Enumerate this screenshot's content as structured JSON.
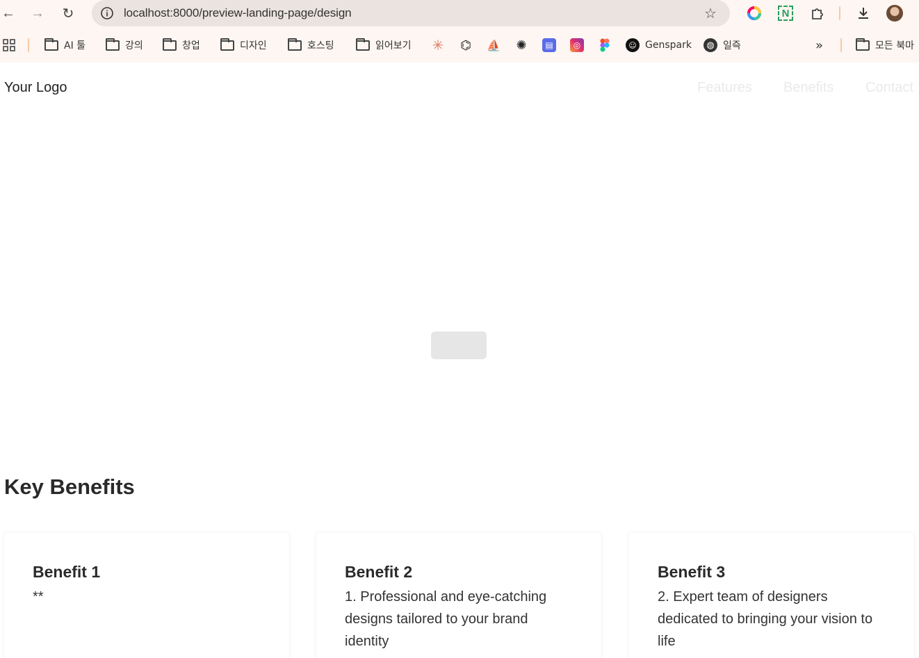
{
  "browser": {
    "url": "localhost:8000/preview-landing-page/design",
    "bookmarks": [
      {
        "label": "AI 툴",
        "type": "folder"
      },
      {
        "label": "강의",
        "type": "folder"
      },
      {
        "label": "창업",
        "type": "folder"
      },
      {
        "label": "디자인",
        "type": "folder"
      },
      {
        "label": "호스팅",
        "type": "folder"
      },
      {
        "label": "읽어보기",
        "type": "folder"
      },
      {
        "label": "Genspark",
        "type": "site"
      },
      {
        "label": "일즉",
        "type": "site"
      },
      {
        "label": "모든 북마",
        "type": "folder"
      }
    ],
    "overflow_label": "»"
  },
  "header": {
    "logo": "Your Logo",
    "nav": [
      "Features",
      "Benefits",
      "Contact"
    ]
  },
  "benefits": {
    "title": "Key Benefits",
    "cards": [
      {
        "title": "Benefit 1",
        "text": "**"
      },
      {
        "title": "Benefit 2",
        "text": "1. Professional and eye-catching designs tailored to your brand identity"
      },
      {
        "title": "Benefit 3",
        "text": "2. Expert team of designers dedicated to bringing your vision to life"
      }
    ]
  },
  "colors": {
    "chrome_bg": "#fdf6f2",
    "omnibox_bg": "#eae3df",
    "nav_text": "#eaeaea",
    "hero_button": "#e6e6e6"
  }
}
